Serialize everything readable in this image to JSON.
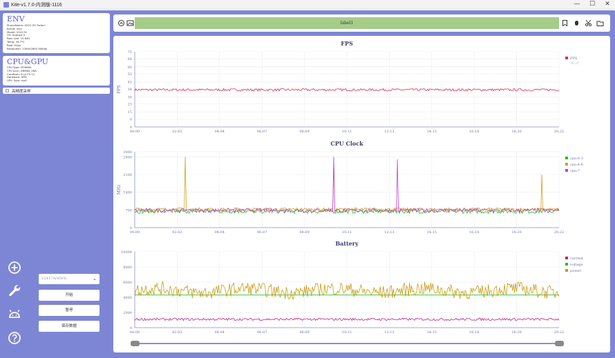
{
  "window": {
    "title": "Kite-v1.7.0-内测版-1116",
    "controls": [
      "—",
      "☐",
      "✕"
    ]
  },
  "env": {
    "title": "ENV",
    "lines": [
      "PhoneName: iQOO Z9 Turbo+",
      "Brand: vivo",
      "Model: V2417A",
      "OS: Android 0",
      "Ram size: 15.64G",
      "Temp: 34.7ºC",
      "Root: false",
      "Resolution: 1260x2800 560dpi"
    ]
  },
  "cpu_gpu": {
    "title": "CPU&GPU",
    "lines": [
      "CPU Type: MT6989",
      "CPU Arch: ARM64_V8A",
      "CoreNum: 8 (4+3+1)",
      "Hardware: MTK",
      "GPU Type: mali"
    ]
  },
  "high_precision": {
    "label": "高精度采样",
    "checked": false
  },
  "sidebar_icons": [
    "add-circle-icon",
    "wrench-icon",
    "android-icon",
    "help-circle-icon"
  ],
  "controls": {
    "device_select": "V2417A(WIFI)",
    "start_label": "开始",
    "pause_label": "暂停",
    "save_label": "保存数据"
  },
  "toolbar": {
    "label": "label1",
    "left_icons": [
      "record-icon",
      "screenshot-icon"
    ],
    "right_icons": [
      "bookmark-icon",
      "mouse-icon",
      "cut-icon",
      "folder-icon"
    ]
  },
  "x_ticks": [
    "00:00",
    "02:02",
    "04:04",
    "06:07",
    "08:09",
    "10:11",
    "12:13",
    "14:15",
    "16:18",
    "18:20",
    "20:22"
  ],
  "slider": {
    "start": 0,
    "end": 1
  },
  "chart_data": [
    {
      "type": "line",
      "title": "FPS",
      "ylabel": "FPS",
      "ylim": [
        0,
        75
      ],
      "yticks": [
        0,
        8,
        15,
        23,
        30,
        38,
        45,
        53,
        60,
        68,
        75
      ],
      "series": [
        {
          "name": "FPS",
          "color": "#e0304a",
          "mean": 37,
          "noise": 1.2
        }
      ],
      "legend_extra": "36.21",
      "grid": true,
      "legend": "right"
    },
    {
      "type": "line",
      "title": "CPU Clock",
      "ylabel": "MHz",
      "ylim": [
        0,
        3000
      ],
      "yticks": [
        0,
        700,
        1400,
        2100,
        2800,
        3000
      ],
      "ytick_labels": [
        "0",
        "700",
        "1400",
        "2100",
        "2800",
        "3000"
      ],
      "series": [
        {
          "name": "cpu:0-3",
          "color": "#22c022",
          "mean": 650,
          "noise": 90
        },
        {
          "name": "cpu:4-6",
          "color": "#d4a017",
          "mean": 720,
          "noise": 70,
          "spikes": [
            [
              0.12,
              2800
            ],
            [
              0.47,
              2600
            ],
            [
              0.96,
              2100
            ]
          ]
        },
        {
          "name": "cpu:7",
          "color": "#c040e0",
          "mean": 680,
          "noise": 80,
          "spikes": [
            [
              0.47,
              2800
            ],
            [
              0.62,
              2700
            ]
          ]
        }
      ],
      "grid": true,
      "legend": "right"
    },
    {
      "type": "line",
      "title": "Battery",
      "ylabel": "",
      "ylim": [
        0,
        10000
      ],
      "yticks": [
        0,
        2000,
        4000,
        6000,
        8000,
        10000
      ],
      "series": [
        {
          "name": "current",
          "color": "#c0208a",
          "mean": 1100,
          "noise": 160
        },
        {
          "name": "voltage",
          "color": "#22c022",
          "mean": 4300,
          "noise": 0
        },
        {
          "name": "power",
          "color": "#c89a10",
          "mean": 4900,
          "noise": 900
        }
      ],
      "grid": true,
      "legend": "right"
    }
  ]
}
